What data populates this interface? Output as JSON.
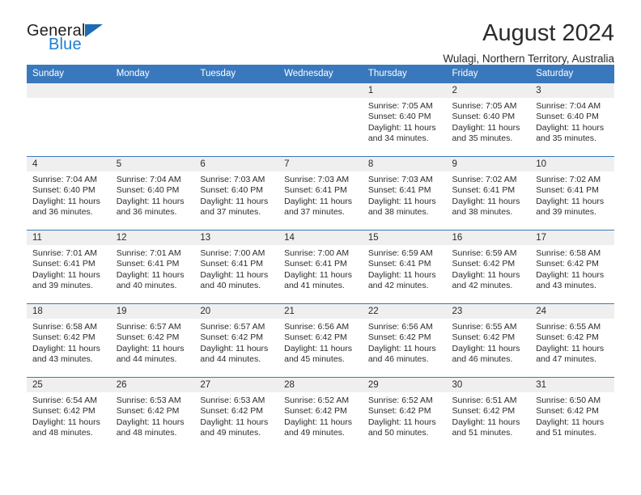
{
  "brand": {
    "name_top": "General",
    "name_bottom": "Blue",
    "accent_color": "#1b7fd4",
    "triangle_color": "#1b6cb5"
  },
  "header": {
    "title": "August 2024",
    "subtitle": "Wulagi, Northern Territory, Australia"
  },
  "calendar": {
    "header_bg": "#3a78bd",
    "daynum_band_bg": "#efefef",
    "weekday_headers": [
      "Sunday",
      "Monday",
      "Tuesday",
      "Wednesday",
      "Thursday",
      "Friday",
      "Saturday"
    ],
    "weeks": [
      [
        {
          "day": "",
          "sunrise": "",
          "sunset": "",
          "daylight_line1": "",
          "daylight_line2": ""
        },
        {
          "day": "",
          "sunrise": "",
          "sunset": "",
          "daylight_line1": "",
          "daylight_line2": ""
        },
        {
          "day": "",
          "sunrise": "",
          "sunset": "",
          "daylight_line1": "",
          "daylight_line2": ""
        },
        {
          "day": "",
          "sunrise": "",
          "sunset": "",
          "daylight_line1": "",
          "daylight_line2": ""
        },
        {
          "day": "1",
          "sunrise": "Sunrise: 7:05 AM",
          "sunset": "Sunset: 6:40 PM",
          "daylight_line1": "Daylight: 11 hours",
          "daylight_line2": "and 34 minutes."
        },
        {
          "day": "2",
          "sunrise": "Sunrise: 7:05 AM",
          "sunset": "Sunset: 6:40 PM",
          "daylight_line1": "Daylight: 11 hours",
          "daylight_line2": "and 35 minutes."
        },
        {
          "day": "3",
          "sunrise": "Sunrise: 7:04 AM",
          "sunset": "Sunset: 6:40 PM",
          "daylight_line1": "Daylight: 11 hours",
          "daylight_line2": "and 35 minutes."
        }
      ],
      [
        {
          "day": "4",
          "sunrise": "Sunrise: 7:04 AM",
          "sunset": "Sunset: 6:40 PM",
          "daylight_line1": "Daylight: 11 hours",
          "daylight_line2": "and 36 minutes."
        },
        {
          "day": "5",
          "sunrise": "Sunrise: 7:04 AM",
          "sunset": "Sunset: 6:40 PM",
          "daylight_line1": "Daylight: 11 hours",
          "daylight_line2": "and 36 minutes."
        },
        {
          "day": "6",
          "sunrise": "Sunrise: 7:03 AM",
          "sunset": "Sunset: 6:40 PM",
          "daylight_line1": "Daylight: 11 hours",
          "daylight_line2": "and 37 minutes."
        },
        {
          "day": "7",
          "sunrise": "Sunrise: 7:03 AM",
          "sunset": "Sunset: 6:41 PM",
          "daylight_line1": "Daylight: 11 hours",
          "daylight_line2": "and 37 minutes."
        },
        {
          "day": "8",
          "sunrise": "Sunrise: 7:03 AM",
          "sunset": "Sunset: 6:41 PM",
          "daylight_line1": "Daylight: 11 hours",
          "daylight_line2": "and 38 minutes."
        },
        {
          "day": "9",
          "sunrise": "Sunrise: 7:02 AM",
          "sunset": "Sunset: 6:41 PM",
          "daylight_line1": "Daylight: 11 hours",
          "daylight_line2": "and 38 minutes."
        },
        {
          "day": "10",
          "sunrise": "Sunrise: 7:02 AM",
          "sunset": "Sunset: 6:41 PM",
          "daylight_line1": "Daylight: 11 hours",
          "daylight_line2": "and 39 minutes."
        }
      ],
      [
        {
          "day": "11",
          "sunrise": "Sunrise: 7:01 AM",
          "sunset": "Sunset: 6:41 PM",
          "daylight_line1": "Daylight: 11 hours",
          "daylight_line2": "and 39 minutes."
        },
        {
          "day": "12",
          "sunrise": "Sunrise: 7:01 AM",
          "sunset": "Sunset: 6:41 PM",
          "daylight_line1": "Daylight: 11 hours",
          "daylight_line2": "and 40 minutes."
        },
        {
          "day": "13",
          "sunrise": "Sunrise: 7:00 AM",
          "sunset": "Sunset: 6:41 PM",
          "daylight_line1": "Daylight: 11 hours",
          "daylight_line2": "and 40 minutes."
        },
        {
          "day": "14",
          "sunrise": "Sunrise: 7:00 AM",
          "sunset": "Sunset: 6:41 PM",
          "daylight_line1": "Daylight: 11 hours",
          "daylight_line2": "and 41 minutes."
        },
        {
          "day": "15",
          "sunrise": "Sunrise: 6:59 AM",
          "sunset": "Sunset: 6:41 PM",
          "daylight_line1": "Daylight: 11 hours",
          "daylight_line2": "and 42 minutes."
        },
        {
          "day": "16",
          "sunrise": "Sunrise: 6:59 AM",
          "sunset": "Sunset: 6:42 PM",
          "daylight_line1": "Daylight: 11 hours",
          "daylight_line2": "and 42 minutes."
        },
        {
          "day": "17",
          "sunrise": "Sunrise: 6:58 AM",
          "sunset": "Sunset: 6:42 PM",
          "daylight_line1": "Daylight: 11 hours",
          "daylight_line2": "and 43 minutes."
        }
      ],
      [
        {
          "day": "18",
          "sunrise": "Sunrise: 6:58 AM",
          "sunset": "Sunset: 6:42 PM",
          "daylight_line1": "Daylight: 11 hours",
          "daylight_line2": "and 43 minutes."
        },
        {
          "day": "19",
          "sunrise": "Sunrise: 6:57 AM",
          "sunset": "Sunset: 6:42 PM",
          "daylight_line1": "Daylight: 11 hours",
          "daylight_line2": "and 44 minutes."
        },
        {
          "day": "20",
          "sunrise": "Sunrise: 6:57 AM",
          "sunset": "Sunset: 6:42 PM",
          "daylight_line1": "Daylight: 11 hours",
          "daylight_line2": "and 44 minutes."
        },
        {
          "day": "21",
          "sunrise": "Sunrise: 6:56 AM",
          "sunset": "Sunset: 6:42 PM",
          "daylight_line1": "Daylight: 11 hours",
          "daylight_line2": "and 45 minutes."
        },
        {
          "day": "22",
          "sunrise": "Sunrise: 6:56 AM",
          "sunset": "Sunset: 6:42 PM",
          "daylight_line1": "Daylight: 11 hours",
          "daylight_line2": "and 46 minutes."
        },
        {
          "day": "23",
          "sunrise": "Sunrise: 6:55 AM",
          "sunset": "Sunset: 6:42 PM",
          "daylight_line1": "Daylight: 11 hours",
          "daylight_line2": "and 46 minutes."
        },
        {
          "day": "24",
          "sunrise": "Sunrise: 6:55 AM",
          "sunset": "Sunset: 6:42 PM",
          "daylight_line1": "Daylight: 11 hours",
          "daylight_line2": "and 47 minutes."
        }
      ],
      [
        {
          "day": "25",
          "sunrise": "Sunrise: 6:54 AM",
          "sunset": "Sunset: 6:42 PM",
          "daylight_line1": "Daylight: 11 hours",
          "daylight_line2": "and 48 minutes."
        },
        {
          "day": "26",
          "sunrise": "Sunrise: 6:53 AM",
          "sunset": "Sunset: 6:42 PM",
          "daylight_line1": "Daylight: 11 hours",
          "daylight_line2": "and 48 minutes."
        },
        {
          "day": "27",
          "sunrise": "Sunrise: 6:53 AM",
          "sunset": "Sunset: 6:42 PM",
          "daylight_line1": "Daylight: 11 hours",
          "daylight_line2": "and 49 minutes."
        },
        {
          "day": "28",
          "sunrise": "Sunrise: 6:52 AM",
          "sunset": "Sunset: 6:42 PM",
          "daylight_line1": "Daylight: 11 hours",
          "daylight_line2": "and 49 minutes."
        },
        {
          "day": "29",
          "sunrise": "Sunrise: 6:52 AM",
          "sunset": "Sunset: 6:42 PM",
          "daylight_line1": "Daylight: 11 hours",
          "daylight_line2": "and 50 minutes."
        },
        {
          "day": "30",
          "sunrise": "Sunrise: 6:51 AM",
          "sunset": "Sunset: 6:42 PM",
          "daylight_line1": "Daylight: 11 hours",
          "daylight_line2": "and 51 minutes."
        },
        {
          "day": "31",
          "sunrise": "Sunrise: 6:50 AM",
          "sunset": "Sunset: 6:42 PM",
          "daylight_line1": "Daylight: 11 hours",
          "daylight_line2": "and 51 minutes."
        }
      ]
    ]
  }
}
